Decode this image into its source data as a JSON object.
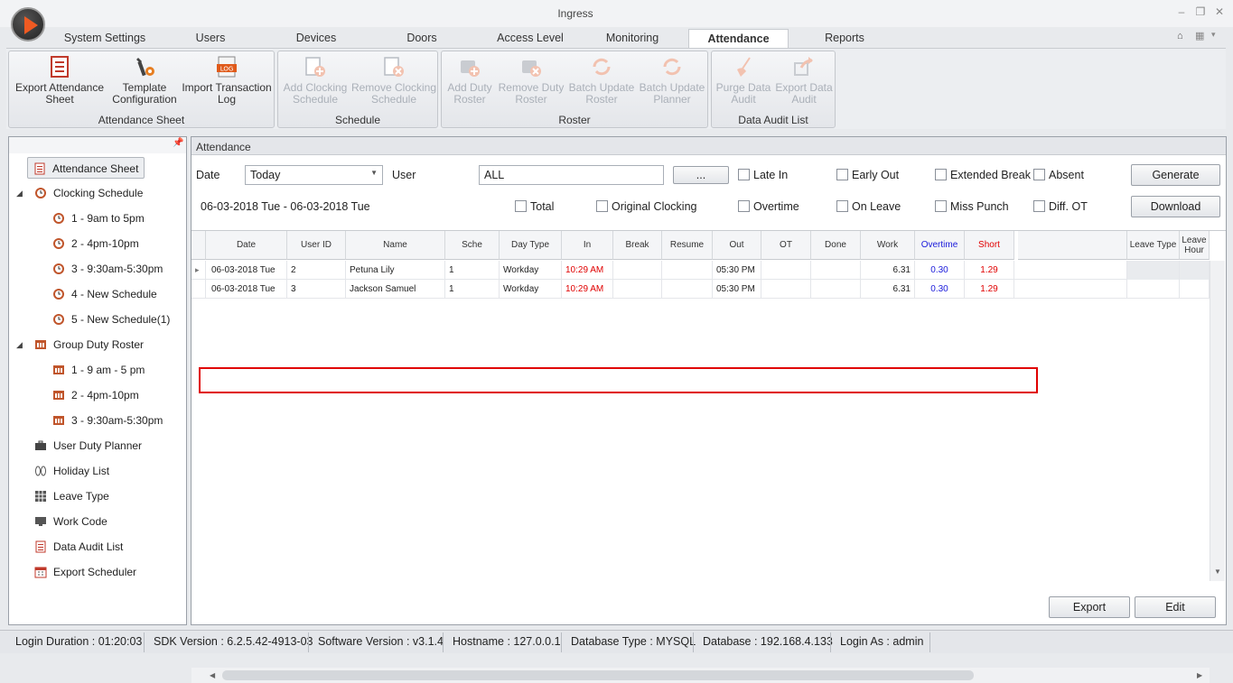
{
  "window": {
    "title": "Ingress"
  },
  "tabs": [
    "System Settings",
    "Users",
    "Devices",
    "Doors",
    "Access Level",
    "Monitoring",
    "Attendance",
    "Reports"
  ],
  "active_tab": "Attendance",
  "ribbon": {
    "groups": [
      {
        "label": "Attendance Sheet",
        "buttons": [
          {
            "l1": "Export Attendance",
            "l2": "Sheet",
            "icon": "sheet-icon",
            "enabled": true
          },
          {
            "l1": "Template",
            "l2": "Configuration",
            "icon": "wrench-gear-icon",
            "enabled": true
          },
          {
            "l1": "Import Transaction",
            "l2": "Log",
            "icon": "log-file-icon",
            "enabled": true
          }
        ]
      },
      {
        "label": "Schedule",
        "buttons": [
          {
            "l1": "Add Clocking",
            "l2": "Schedule",
            "icon": "add-schedule-icon",
            "enabled": false
          },
          {
            "l1": "Remove Clocking",
            "l2": "Schedule",
            "icon": "remove-schedule-icon",
            "enabled": false
          }
        ]
      },
      {
        "label": "Roster",
        "buttons": [
          {
            "l1": "Add Duty",
            "l2": "Roster",
            "icon": "add-roster-icon",
            "enabled": false
          },
          {
            "l1": "Remove Duty",
            "l2": "Roster",
            "icon": "remove-roster-icon",
            "enabled": false
          },
          {
            "l1": "Batch Update",
            "l2": "Roster",
            "icon": "refresh-icon",
            "enabled": false
          },
          {
            "l1": "Batch Update",
            "l2": "Planner",
            "icon": "refresh-icon",
            "enabled": false
          }
        ]
      },
      {
        "label": "Data Audit List",
        "buttons": [
          {
            "l1": "Purge Data",
            "l2": "Audit",
            "icon": "broom-icon",
            "enabled": false
          },
          {
            "l1": "Export Data",
            "l2": "Audit",
            "icon": "export-arrow-icon",
            "enabled": false
          }
        ]
      }
    ]
  },
  "sidebar": {
    "items": [
      {
        "label": "Attendance Sheet",
        "icon": "sheet-icon",
        "selected": true
      },
      {
        "label": "Clocking Schedule",
        "icon": "clock-icon",
        "expanded": true
      },
      {
        "label": "1 - 9am to 5pm",
        "icon": "clock-icon"
      },
      {
        "label": "2 - 4pm-10pm",
        "icon": "clock-icon"
      },
      {
        "label": "3 - 9:30am-5:30pm",
        "icon": "clock-icon"
      },
      {
        "label": "4 - New Schedule",
        "icon": "clock-icon"
      },
      {
        "label": "5 - New Schedule(1)",
        "icon": "clock-icon"
      },
      {
        "label": "Group Duty Roster",
        "icon": "roster-icon",
        "expanded": true
      },
      {
        "label": "1 - 9 am - 5 pm",
        "icon": "roster-icon"
      },
      {
        "label": "2 - 4pm-10pm",
        "icon": "roster-icon"
      },
      {
        "label": "3 - 9:30am-5:30pm",
        "icon": "roster-icon"
      },
      {
        "label": "User Duty Planner",
        "icon": "briefcase-icon"
      },
      {
        "label": "Holiday List",
        "icon": "sandals-icon"
      },
      {
        "label": "Leave Type",
        "icon": "grid-icon"
      },
      {
        "label": "Work Code",
        "icon": "monitor-icon"
      },
      {
        "label": "Data Audit List",
        "icon": "list-icon"
      },
      {
        "label": "Export Scheduler",
        "icon": "calendar-icon"
      }
    ]
  },
  "main": {
    "title": "Attendance",
    "date_label": "Date",
    "date_value": "Today",
    "user_label": "User",
    "user_value": "ALL",
    "browse_label": "...",
    "date_range": "06-03-2018 Tue - 06-03-2018 Tue",
    "filters_row1": [
      "Late In",
      "Early Out",
      "Extended Break",
      "Absent"
    ],
    "filters_row2": [
      "Total",
      "Original Clocking",
      "Overtime",
      "On Leave",
      "Miss Punch",
      "Diff. OT"
    ],
    "generate_label": "Generate",
    "download_label": "Download",
    "export_label": "Export",
    "edit_label": "Edit",
    "columns": [
      "Date",
      "User ID",
      "Name",
      "Sche",
      "Day Type",
      "In",
      "Break",
      "Resume",
      "Out",
      "OT",
      "Done",
      "Work",
      "Overtime",
      "Short",
      "Leave Type",
      "Leave\nHour"
    ],
    "rows": [
      {
        "date": "06-03-2018  Tue",
        "user_id": "2",
        "name": "Petuna Lily",
        "sche": "1",
        "day_type": "Workday",
        "in": "10:29 AM",
        "break": "",
        "resume": "",
        "out": "05:30 PM",
        "ot": "",
        "done": "",
        "work": "6.31",
        "overtime": "0.30",
        "short": "1.29",
        "leave_type": "",
        "leave_hour": ""
      },
      {
        "date": "06-03-2018  Tue",
        "user_id": "3",
        "name": "Jackson Samuel",
        "sche": "1",
        "day_type": "Workday",
        "in": "10:29 AM",
        "break": "",
        "resume": "",
        "out": "05:30 PM",
        "ot": "",
        "done": "",
        "work": "6.31",
        "overtime": "0.30",
        "short": "1.29",
        "leave_type": "",
        "leave_hour": ""
      }
    ]
  },
  "status": {
    "login_duration": "Login Duration : 01:20:03",
    "sdk": "SDK Version : 6.2.5.42-4913-03",
    "software": "Software Version : v3.1.4",
    "hostname": "Hostname : 127.0.0.1",
    "db_type": "Database Type : MYSQL",
    "database": "Database : 192.168.4.133",
    "login_as": "Login As : admin"
  },
  "colors": {
    "accent_red": "#e00000",
    "overtime_blue": "#1a1adb",
    "short_red": "#e00000",
    "logo_orange": "#f05a22"
  }
}
